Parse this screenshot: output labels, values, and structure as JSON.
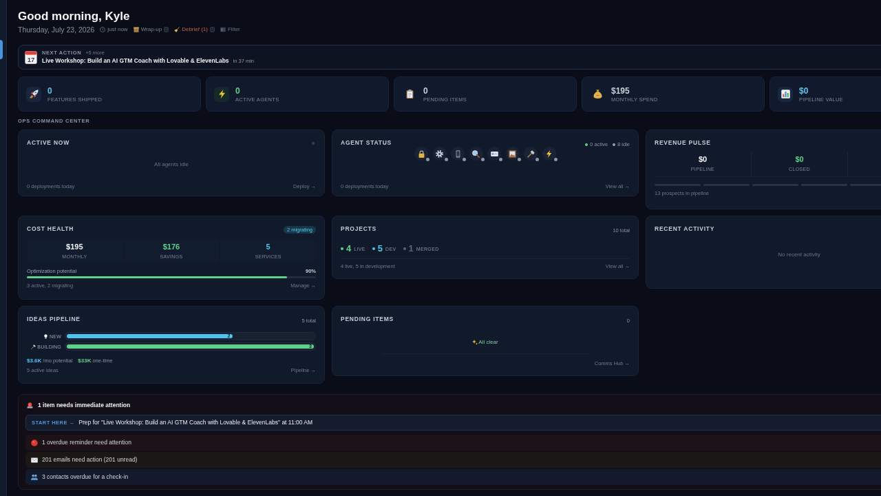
{
  "sidebar": {
    "items": [
      {
        "selected": true
      }
    ]
  },
  "header": {
    "greeting": "Good morning, Kyle",
    "date": "Thursday, July 23, 2026",
    "meta": [
      {
        "kind": "clock",
        "label": "just now",
        "shortcut": false
      },
      {
        "kind": "box",
        "label": "Wrap-up",
        "shortcut": true
      },
      {
        "kind": "broom",
        "label": "Debrief (1)",
        "shortcut": true
      },
      {
        "kind": "panel",
        "label": "Filter",
        "shortcut": false
      }
    ]
  },
  "next_action": {
    "label": "NEXT ACTION",
    "more": "+5 more",
    "calendar_day": "17",
    "title": "Live Workshop: Build an AI GTM Coach with Lovable & ElevenLabs",
    "eta": "in 37 min"
  },
  "stats": [
    {
      "kind": "rocket",
      "value": "0",
      "label": "FEATURES SHIPPED",
      "color": "#5ec4ec"
    },
    {
      "kind": "bolt",
      "value": "0",
      "label": "ACTIVE AGENTS",
      "color": "#5fd08a"
    },
    {
      "kind": "clipboard",
      "value": "0",
      "label": "PENDING ITEMS",
      "color": "#c9ced8"
    },
    {
      "kind": "moneybag",
      "value": "$195",
      "label": "MONTHLY SPEND",
      "color": "#c9ced8"
    },
    {
      "kind": "chart",
      "value": "$0",
      "label": "PIPELINE VALUE",
      "color": "#5ec4ec"
    }
  ],
  "ops": {
    "title": "OPS COMMAND CENTER",
    "active_now": {
      "title": "ACTIVE NOW",
      "live": false,
      "empty": "All agents idle",
      "footer": "0 deployments today",
      "link": "Deploy →"
    },
    "agent_status": {
      "title": "AGENT STATUS",
      "legend": [
        {
          "label": "0 active",
          "color": "#5fd08a"
        },
        {
          "label": "8 idle",
          "color": "#9aa3b2"
        }
      ],
      "agents": [
        {
          "kind": "lock",
          "active": false
        },
        {
          "kind": "gear",
          "active": false
        },
        {
          "kind": "phone",
          "active": false
        },
        {
          "kind": "magnifier",
          "active": false
        },
        {
          "kind": "card",
          "active": false
        },
        {
          "kind": "picture",
          "active": false
        },
        {
          "kind": "hammer",
          "active": false
        },
        {
          "kind": "bolt",
          "active": false
        }
      ],
      "footer": "0 deployments today",
      "link": "View all →"
    },
    "revenue_pulse": {
      "title": "REVENUE PULSE",
      "metrics": [
        {
          "value": "$0",
          "label": "PIPELINE",
          "color": "#f2f4f7"
        },
        {
          "value": "$0",
          "label": "CLOSED",
          "color": "#5fd08a"
        }
      ],
      "footer": "13 prospects in pipeline"
    },
    "cost_health": {
      "title": "COST HEALTH",
      "badge": "2 migrating",
      "metrics": [
        {
          "value": "$195",
          "label": "MONTHLY",
          "color": "#f2f4f7"
        },
        {
          "value": "$176",
          "label": "SAVINGS",
          "color": "#5fd08a"
        },
        {
          "value": "5",
          "label": "SERVICES",
          "color": "#4cc6ee"
        }
      ],
      "progress": {
        "label": "Optimization potential",
        "reading": "90%",
        "level": 0.9
      },
      "footer": "3 active, 2 migrating",
      "link": "Manage →"
    },
    "projects": {
      "title": "PROJECTS",
      "total": "10 total",
      "statuses": [
        {
          "count": "4",
          "label": "LIVE",
          "color": "#5fd08a"
        },
        {
          "count": "5",
          "label": "DEV",
          "color": "#4cc6ee"
        },
        {
          "count": "1",
          "label": "MERGED",
          "color": "#5d6577"
        }
      ],
      "footer": "4 live, 5 in development",
      "link": "View all →"
    },
    "recent_activity": {
      "title": "RECENT ACTIVITY",
      "empty": "No recent activity"
    },
    "ideas_pipeline": {
      "title": "IDEAS PIPELINE",
      "total": "5 total",
      "stages": [
        {
          "kind": "bulb",
          "label": "NEW",
          "count": "2",
          "level": 0.67,
          "color": "#4cc6ee"
        },
        {
          "kind": "hammer",
          "label": "BUILDING",
          "count": "3",
          "level": 1,
          "color": "#5fd08a"
        }
      ],
      "potentials": [
        {
          "value": "$3.6K",
          "suffix": "/mo potential",
          "color": "#4cc6ee"
        },
        {
          "value": "$33K",
          "suffix": "one-time",
          "color": "#5fd08a"
        }
      ],
      "footer": "5 active ideas",
      "link": "Pipeline →"
    },
    "pending_items": {
      "title": "PENDING ITEMS",
      "count": "0",
      "empty": "All clear",
      "link": "Comms Hub →"
    }
  },
  "attention": {
    "title": "1 item needs immediate attention",
    "start": {
      "tag": "START HERE →",
      "text": "Prep for \"Live Workshop: Build an AI GTM Coach with Lovable & ElevenLabs\" at 11:00 AM"
    },
    "items": [
      {
        "kind": "reminder",
        "text": "1 overdue reminder need attention"
      },
      {
        "kind": "email",
        "text": "201 emails need action (201 unread)"
      },
      {
        "kind": "contacts",
        "text": "3 contacts overdue for a check-in"
      }
    ]
  }
}
